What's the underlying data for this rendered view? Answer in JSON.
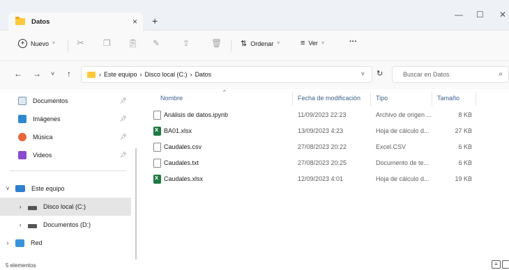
{
  "window": {
    "tab_title": "Datos",
    "tab_close": "×",
    "new_tab": "+",
    "minimize": "—",
    "maximize": "☐",
    "close": "✕"
  },
  "toolbar": {
    "new_label": "Nuevo",
    "sort_label": "Ordenar",
    "view_label": "Ver",
    "more": "···"
  },
  "address": {
    "crumbs": [
      "Este equipo",
      "Disco local (C:)",
      "Datos"
    ],
    "separator": "›",
    "search_placeholder": "Buscar en Datos"
  },
  "nav": {
    "quick": [
      {
        "label": "Documentos",
        "icon": "documents-icon"
      },
      {
        "label": "Imágenes",
        "icon": "pictures-icon"
      },
      {
        "label": "Música",
        "icon": "music-icon"
      },
      {
        "label": "Videos",
        "icon": "videos-icon"
      }
    ],
    "this_pc": "Este equipo",
    "drive_c": "Disco local (C:)",
    "drive_d": "Documentos (D:)",
    "network": "Red"
  },
  "columns": {
    "name": "Nombre",
    "date": "Fecha de modificación",
    "type": "Tipo",
    "size": "Tamaño"
  },
  "files": [
    {
      "name": "Análisis de datos.ipynb",
      "date": "11/09/2023 22:23",
      "type": "Archivo de origen ...",
      "size": "8 KB",
      "icon": "document-icon"
    },
    {
      "name": "BA01.xlsx",
      "date": "13/09/2023 4:23",
      "type": "Hoja de cálculo d...",
      "size": "27 KB",
      "icon": "excel-icon"
    },
    {
      "name": "Caudales.csv",
      "date": "27/08/2023 20:22",
      "type": "Excel.CSV",
      "size": "6 KB",
      "icon": "document-icon"
    },
    {
      "name": "Caudales.txt",
      "date": "27/08/2023 20:25",
      "type": "Documento de te...",
      "size": "6 KB",
      "icon": "document-icon"
    },
    {
      "name": "Caudales.xlsx",
      "date": "12/09/2023 4:01",
      "type": "Hoja de cálculo d...",
      "size": "19 KB",
      "icon": "excel-icon"
    }
  ],
  "status": {
    "count": "5 elementos"
  },
  "colors": {
    "accent": "#0067c0",
    "folder": "#ffc83d",
    "excel": "#1d7845",
    "selection": "#e5e5e5"
  }
}
